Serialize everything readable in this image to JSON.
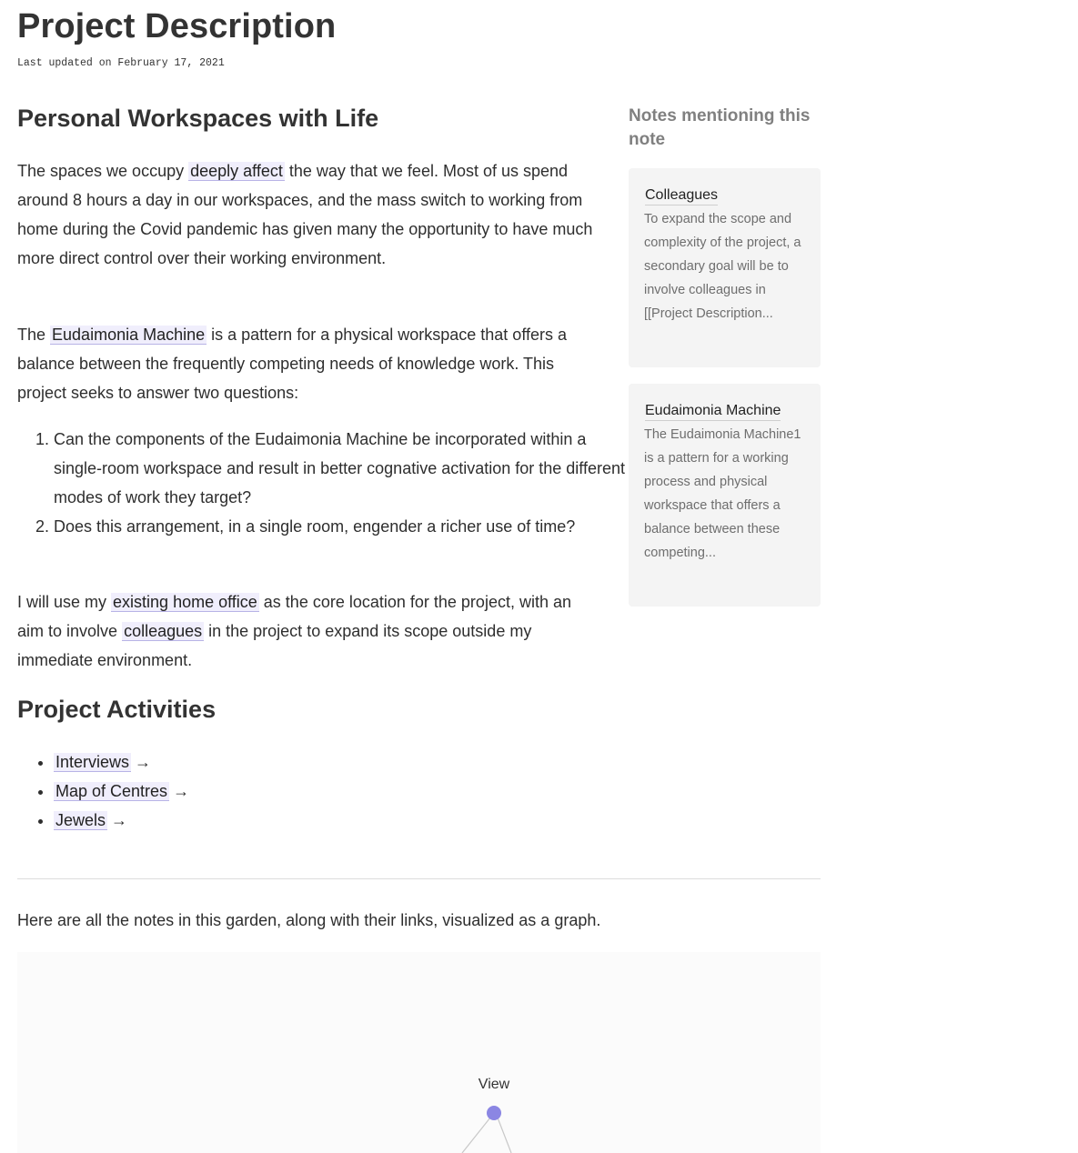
{
  "note": {
    "title": "Project Description",
    "updated": "Last updated on February 17, 2021"
  },
  "content": {
    "heading1": "Personal Workspaces with Life",
    "p1_a": "The spaces we occupy ",
    "p1_link": "deeply affect",
    "p1_b": " the way that we feel. Most of us spend around 8 hours a day in our workspaces, and the mass switch to working from home during the Covid pandemic has given many the opportunity to have much more direct control over their working environment.",
    "p2_a": "The ",
    "p2_link": "Eudaimonia Machine",
    "p2_b": " is a pattern for a physical workspace that offers a balance between the frequently competing needs of knowledge work. This project seeks to answer two questions:",
    "questions": [
      "Can the components of the Eudaimonia Machine be incorporated within a single-room workspace and result in better cognative activation for the different modes of work they target?",
      "Does this arrangement, in a single room, engender a richer use of time?"
    ],
    "p3_a": "I will use my ",
    "p3_link1": "existing home office",
    "p3_b": " as the core location for the project, with an aim to involve ",
    "p3_link2": "colleagues",
    "p3_c": " in the project to expand its scope outside my immediate environment.",
    "heading2": "Project Activities",
    "activities": [
      {
        "label": "Interviews",
        "arrow": "→"
      },
      {
        "label": "Map of Centres",
        "arrow": "→"
      },
      {
        "label": "Jewels",
        "arrow": "→"
      }
    ]
  },
  "backlinks": {
    "heading": "Notes mentioning this note",
    "items": [
      {
        "title": "Colleagues",
        "excerpt": "To expand the scope and complexity of the project, a secondary goal will be to involve colleagues in [[Project Description..."
      },
      {
        "title": "Eudaimonia Machine",
        "excerpt": "The Eudaimonia Machine1 is a pattern for a working process and physical workspace that offers a balance between these competing..."
      }
    ]
  },
  "graph": {
    "intro": "Here are all the notes in this garden, along with their links, visualized as a graph.",
    "nodes": [
      {
        "label": "View",
        "color": "#8b86e3"
      }
    ],
    "edge_color": "#c8c8c8"
  },
  "colors": {
    "link_background": "#f0eefc",
    "link_underline": "#b8b3e6",
    "card_background": "#f4f4f4"
  }
}
